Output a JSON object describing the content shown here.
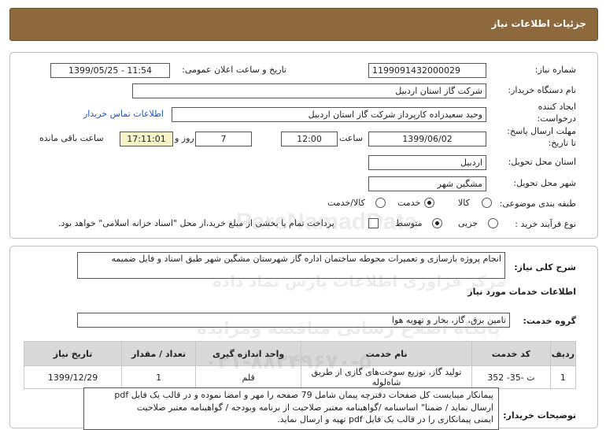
{
  "header": {
    "title": "جزئیات اطلاعات نیاز"
  },
  "fields": {
    "need_number_label": "شماره نیاز:",
    "need_number": "1199091432000029",
    "announce_label": "تاریخ و ساعت اعلان عمومی:",
    "announce_value": "1399/05/25 - 11:54",
    "buyer_org_label": "نام دستگاه خریدار:",
    "buyer_org": "شرکت گاز استان اردبیل",
    "creator_label_1": "ایجاد کننده",
    "creator_label_2": "درخواست:",
    "creator": "وحید سعیدزاده کارپرداز شرکت گاز استان اردبیل",
    "contact_link": "اطلاعات تماس خریدار",
    "deadline_label_1": "مهلت ارسال پاسخ:",
    "deadline_label_2": "تا تاریخ:",
    "deadline_date": "1399/06/02",
    "hour_label": "ساعت",
    "deadline_time": "12:00",
    "days": "7",
    "days_label": "روز و",
    "remaining_time": "17:11:01",
    "remaining_label": "ساعت باقی مانده",
    "province_label": "استان محل تحویل:",
    "province": "اردبیل",
    "city_label": "شهر محل تحویل:",
    "city": "مشگین شهر",
    "category_label": "طبقه بندی موضوعی:",
    "category_options": [
      "کالا",
      "خدمت",
      "کالا/خدمت"
    ],
    "category_selected": "خدمت",
    "process_label": "نوع فرآیند خرید :",
    "process_options": [
      "جزیی",
      "متوسط"
    ],
    "process_selected": "متوسط",
    "payment_note": "پرداخت تمام یا بخشی از مبلغ خرید،از محل \"اسناد خزانه اسلامی\" خواهد بود."
  },
  "summary": {
    "label": "شرح کلی نیاز:",
    "value": "انجام پروژه بازسازی و تعمیرات محوطه ساختمان اداره گاز شهرستان مشگین شهر طبق اسناد و فایل ضمیمه"
  },
  "services": {
    "section_title": "اطلاعات خدمات مورد نیاز",
    "group_label": "گروه خدمت:",
    "group_value": "تامین برق، گاز، بخار و تهویه هوا",
    "columns": [
      "ردیف",
      "کد خدمت",
      "نام خدمت",
      "واحد اندازه گیری",
      "تعداد / مقدار",
      "تاریخ نیاز"
    ],
    "rows": [
      [
        "1",
        "ت -35- 352",
        "تولید گاز، توزیع سوخت‌های گازی از طریق شاه‌لوله",
        "قلم",
        "1",
        "1399/12/29"
      ]
    ]
  },
  "notes": {
    "label": "توضیحات خریدار:",
    "lines": [
      "پیمانکار میبایست کل صفحات دفترچه پیمان شامل 79 صفحه را مهر و امضا نموده و در قالب یک فایل pdf",
      "ارسال نماید  / ضمنا\" اساسنامه /گواهینامه معتبر صلاحیت از برنامه وبودجه / گواهینامه معتبر صلاحیت",
      "ایمنی پیمانکاری را در قالب یک فایل pdf تهیه و ارسال نماید."
    ]
  },
  "watermark": {
    "brand": "ParsNamadData",
    "line1": "مرکز فراوری اطلاعات پارس نماد داده",
    "line2": "پایگاه اطلاع رسانی مناقصه ومزایده",
    "phone": "۰۲۱-۸۸۳۴۹۶۷۰-۵"
  }
}
